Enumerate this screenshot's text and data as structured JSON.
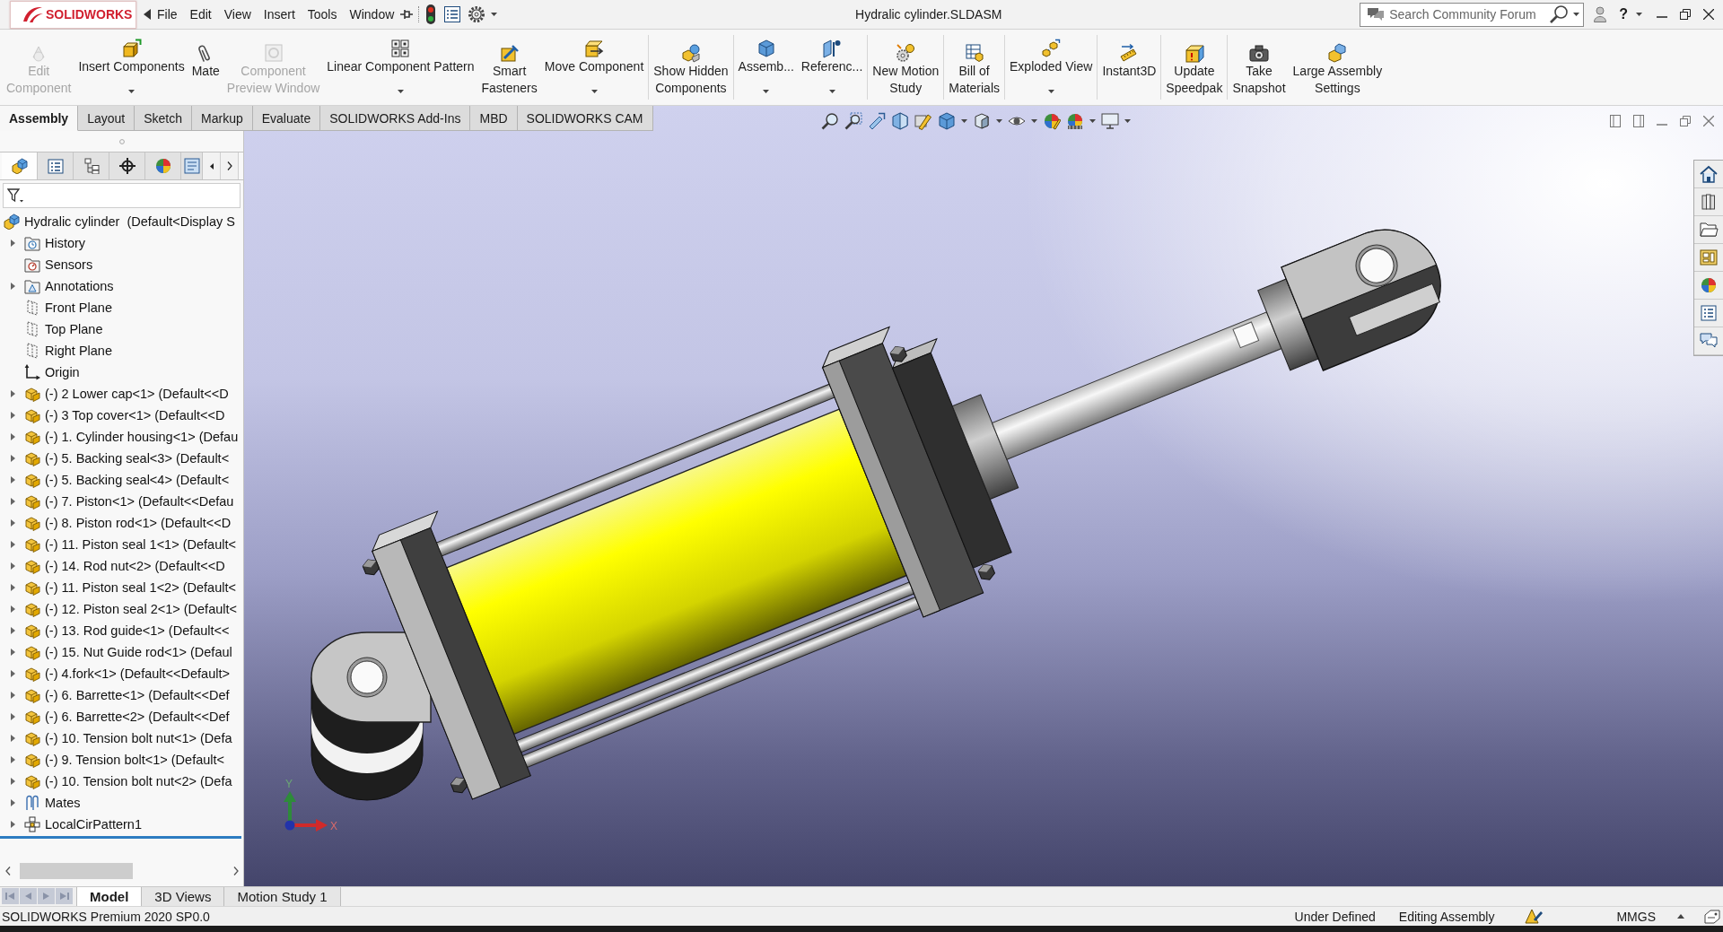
{
  "title_bar": {
    "logo_text": "SOLIDWORKS",
    "menus": [
      "File",
      "Edit",
      "View",
      "Insert",
      "Tools",
      "Window"
    ],
    "title": "Hydralic cylinder.SLDASM",
    "search": {
      "placeholder": "Search Community Forum"
    },
    "help": "?"
  },
  "ribbon": {
    "groups": [
      {
        "buttons": [
          {
            "label": "Edit\nComponent",
            "disabled": true,
            "dropdown": false
          },
          {
            "label": "Insert Components",
            "disabled": false,
            "dropdown": true
          },
          {
            "label": "Mate",
            "disabled": false,
            "dropdown": false
          },
          {
            "label": "Component\nPreview Window",
            "disabled": true,
            "dropdown": false
          },
          {
            "label": "Linear Component Pattern",
            "disabled": false,
            "dropdown": true
          },
          {
            "label": "Smart\nFasteners",
            "disabled": false,
            "dropdown": false
          },
          {
            "label": "Move Component",
            "disabled": false,
            "dropdown": true
          }
        ]
      },
      {
        "buttons": [
          {
            "label": "Show Hidden\nComponents",
            "disabled": false,
            "dropdown": false
          }
        ]
      },
      {
        "buttons": [
          {
            "label": "Assemb...",
            "disabled": false,
            "dropdown": true
          },
          {
            "label": "Referenc...",
            "disabled": false,
            "dropdown": true
          }
        ]
      },
      {
        "buttons": [
          {
            "label": "New Motion\nStudy",
            "disabled": false,
            "dropdown": false
          }
        ]
      },
      {
        "buttons": [
          {
            "label": "Bill of\nMaterials",
            "disabled": false,
            "dropdown": false
          }
        ]
      },
      {
        "buttons": [
          {
            "label": "Exploded View",
            "disabled": false,
            "dropdown": true
          }
        ]
      },
      {
        "buttons": [
          {
            "label": "Instant3D",
            "disabled": false,
            "dropdown": false
          }
        ]
      },
      {
        "buttons": [
          {
            "label": "Update\nSpeedpak",
            "disabled": false,
            "dropdown": false
          }
        ]
      },
      {
        "buttons": [
          {
            "label": "Take\nSnapshot",
            "disabled": false,
            "dropdown": false
          },
          {
            "label": "Large Assembly\nSettings",
            "disabled": false,
            "dropdown": false
          }
        ]
      }
    ]
  },
  "command_tabs": [
    {
      "label": "Assembly",
      "selected": true
    },
    {
      "label": "Layout",
      "selected": false
    },
    {
      "label": "Sketch",
      "selected": false
    },
    {
      "label": "Markup",
      "selected": false
    },
    {
      "label": "Evaluate",
      "selected": false
    },
    {
      "label": "SOLIDWORKS Add-Ins",
      "selected": false
    },
    {
      "label": "MBD",
      "selected": false
    },
    {
      "label": "SOLIDWORKS CAM",
      "selected": false
    }
  ],
  "feature_manager": {
    "panel_tabs": [
      {
        "selected": true
      },
      {
        "selected": false
      },
      {
        "selected": false
      },
      {
        "selected": false
      },
      {
        "selected": false
      },
      {
        "selected": false
      }
    ],
    "tree": {
      "label": "Hydralic cylinder  (Default<Display S",
      "kind": "assembly",
      "children": [
        {
          "label": "History",
          "kind": "history",
          "expandable": true
        },
        {
          "label": "Sensors",
          "kind": "sensors",
          "expandable": false
        },
        {
          "label": "Annotations",
          "kind": "annotations",
          "expandable": true
        },
        {
          "label": "Front Plane",
          "kind": "plane",
          "expandable": false
        },
        {
          "label": "Top Plane",
          "kind": "plane",
          "expandable": false
        },
        {
          "label": "Right Plane",
          "kind": "plane",
          "expandable": false
        },
        {
          "label": "Origin",
          "kind": "origin",
          "expandable": false
        },
        {
          "label": "(-) 2 Lower cap<1> (Default<<D",
          "kind": "component",
          "expandable": true
        },
        {
          "label": "(-) 3 Top cover<1> (Default<<D",
          "kind": "component",
          "expandable": true
        },
        {
          "label": "(-) 1. Cylinder housing<1> (Defau",
          "kind": "component",
          "expandable": true
        },
        {
          "label": "(-) 5. Backing seal<3> (Default<",
          "kind": "component",
          "expandable": true
        },
        {
          "label": "(-) 5. Backing seal<4> (Default<",
          "kind": "component",
          "expandable": true
        },
        {
          "label": "(-) 7. Piston<1> (Default<<Defau",
          "kind": "component",
          "expandable": true
        },
        {
          "label": "(-) 8. Piston rod<1> (Default<<D",
          "kind": "component",
          "expandable": true
        },
        {
          "label": "(-) 11. Piston seal 1<1> (Default<",
          "kind": "component",
          "expandable": true
        },
        {
          "label": "(-) 14. Rod nut<2> (Default<<D",
          "kind": "component",
          "expandable": true
        },
        {
          "label": "(-) 11. Piston seal 1<2> (Default<",
          "kind": "component",
          "expandable": true
        },
        {
          "label": "(-) 12. Piston seal 2<1> (Default<",
          "kind": "component",
          "expandable": true
        },
        {
          "label": "(-) 13. Rod guide<1> (Default<<",
          "kind": "component",
          "expandable": true
        },
        {
          "label": "(-) 15. Nut Guide rod<1> (Defaul",
          "kind": "component",
          "expandable": true
        },
        {
          "label": "(-) 4.fork<1> (Default<<Default>",
          "kind": "component",
          "expandable": true
        },
        {
          "label": "(-) 6. Barrette<1> (Default<<Def",
          "kind": "component",
          "expandable": true
        },
        {
          "label": "(-) 6. Barrette<2> (Default<<Def",
          "kind": "component",
          "expandable": true
        },
        {
          "label": "(-) 10. Tension bolt nut<1> (Defa",
          "kind": "component",
          "expandable": true
        },
        {
          "label": "(-) 9. Tension bolt<1> (Default<",
          "kind": "component",
          "expandable": true
        },
        {
          "label": "(-) 10. Tension bolt nut<2> (Defa",
          "kind": "component",
          "expandable": true
        },
        {
          "label": "Mates",
          "kind": "mates",
          "expandable": true
        },
        {
          "label": "LocalCirPattern1",
          "kind": "pattern",
          "expandable": true
        }
      ]
    }
  },
  "viewport": {
    "triad": {
      "x_label": "X",
      "y_label": "Y"
    }
  },
  "bottom_tabs": [
    {
      "label": "Model",
      "selected": true
    },
    {
      "label": "3D Views",
      "selected": false
    },
    {
      "label": "Motion Study 1",
      "selected": false
    }
  ],
  "status_bar": {
    "version": "SOLIDWORKS Premium 2020 SP0.0",
    "definition": "Under Defined",
    "mode": "Editing Assembly",
    "units": "MMGS"
  }
}
